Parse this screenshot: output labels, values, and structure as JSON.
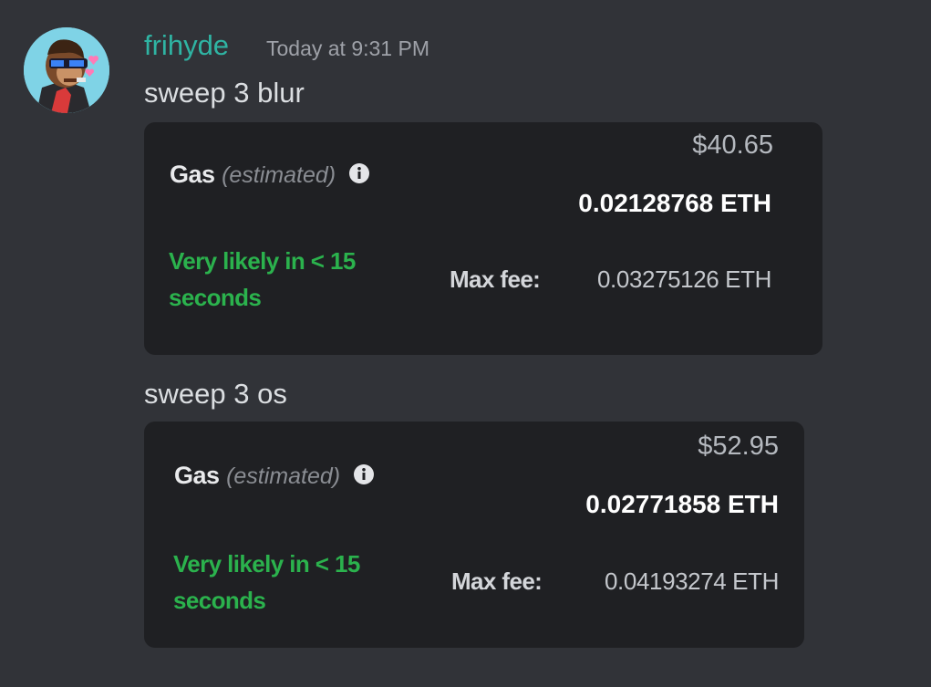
{
  "message": {
    "author": "frihyde",
    "timestamp": "Today at 9:31 PM",
    "avatar_icon": "pixel-ape-avatar-icon",
    "name_color": "#2fb4a3"
  },
  "blocks": [
    {
      "text": "sweep 3 blur",
      "card": {
        "gas_label": "Gas",
        "gas_qualifier": "(estimated)",
        "info_icon": "info-icon",
        "usd": "$40.65",
        "eth": "0.02128768 ETH",
        "likely_line1": "Very likely in < 15",
        "likely_line2": "seconds",
        "max_fee_label": "Max fee:",
        "max_fee_value": "0.03275126 ETH"
      }
    },
    {
      "text": "sweep 3 os",
      "card": {
        "gas_label": "Gas",
        "gas_qualifier": "(estimated)",
        "info_icon": "info-icon",
        "usd": "$52.95",
        "eth": "0.02771858 ETH",
        "likely_line1": "Very likely in < 15",
        "likely_line2": "seconds",
        "max_fee_label": "Max fee:",
        "max_fee_value": "0.04193274 ETH"
      }
    }
  ],
  "colors": {
    "background": "#313338",
    "card": "#1f2023",
    "likely_green": "#2bb24d"
  }
}
